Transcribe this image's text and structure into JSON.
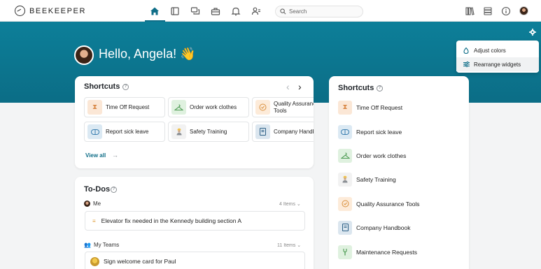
{
  "app": {
    "name": "BEEKEEPER"
  },
  "search": {
    "placeholder": "Search"
  },
  "hero": {
    "greeting": "Hello, Angela! 👋"
  },
  "settings_menu": {
    "items": [
      {
        "label": "Adjust colors",
        "icon": "droplet-icon"
      },
      {
        "label": "Rearrange widgets",
        "icon": "sliders-icon"
      }
    ]
  },
  "shortcuts_widget": {
    "title": "Shortcuts",
    "items": [
      {
        "label": "Time Off Request",
        "icon": "hourglass-icon"
      },
      {
        "label": "Order work clothes",
        "icon": "hanger-icon"
      },
      {
        "label": "Quality Assurance Tools",
        "icon": "checkmark-circle-icon"
      },
      {
        "label": "Report sick leave",
        "icon": "pill-icon"
      },
      {
        "label": "Safety Training",
        "icon": "worker-icon"
      },
      {
        "label": "Company Handb",
        "icon": "handbook-icon"
      }
    ],
    "view_all": "View all"
  },
  "todos": {
    "title": "To-Dos",
    "groups": [
      {
        "label": "Me",
        "count": "4 Items",
        "item": "Elevator fix needed in the Kennedy building section A"
      },
      {
        "label": "My Teams",
        "count": "11 Items",
        "item": "Sign welcome card for Paul"
      }
    ]
  },
  "shortcuts_list": {
    "title": "Shortcuts",
    "items": [
      {
        "label": "Time Off Request",
        "icon": "hourglass-icon"
      },
      {
        "label": "Report sick leave",
        "icon": "pill-icon"
      },
      {
        "label": "Order work clothes",
        "icon": "hanger-icon"
      },
      {
        "label": "Safety Training",
        "icon": "worker-icon"
      },
      {
        "label": "Quality Assurance Tools",
        "icon": "checkmark-circle-icon"
      },
      {
        "label": "Company Handbook",
        "icon": "handbook-icon"
      },
      {
        "label": "Maintenance Requests",
        "icon": "wrench-icon"
      }
    ]
  },
  "colors": {
    "brand": "#0d7f99",
    "accent": "#0f6e88"
  }
}
